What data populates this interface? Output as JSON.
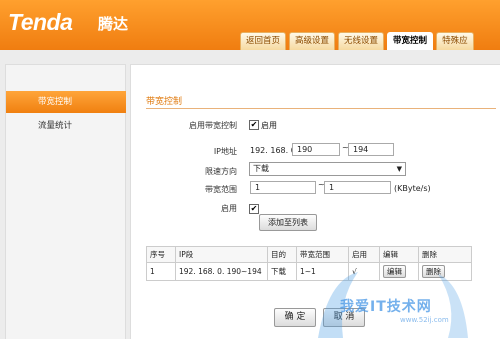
{
  "header": {
    "logo": "Tenda",
    "logo_cn": "腾达",
    "tabs": [
      {
        "label": "返回首页",
        "active": false
      },
      {
        "label": "高级设置",
        "active": false
      },
      {
        "label": "无线设置",
        "active": false
      },
      {
        "label": "带宽控制",
        "active": true
      },
      {
        "label": "特殊应",
        "active": false
      }
    ]
  },
  "sidebar": {
    "items": [
      {
        "label": "带宽控制",
        "active": true
      },
      {
        "label": "流量统计",
        "active": false
      }
    ]
  },
  "form": {
    "section_title": "带宽控制",
    "enable_bw_label": "启用带宽控制",
    "enable_bw_checked": true,
    "enable_bw_text": "启用",
    "ip_label": "IP地址",
    "ip_prefix": "192. 168. 0.",
    "ip_start": "190",
    "ip_sep": "~",
    "ip_end": "194",
    "direction_label": "限速方向",
    "direction_value": "下载",
    "range_label": "带宽范围",
    "range_min": "1",
    "range_sep": "~",
    "range_max": "1",
    "range_unit": "(KByte/s)",
    "enable_label": "启用",
    "enable_checked": true,
    "add_button": "添加至列表"
  },
  "table": {
    "headers": [
      "序号",
      "IP段",
      "目的",
      "带宽范围",
      "启用",
      "编辑",
      "删除"
    ],
    "rows": [
      {
        "index": "1",
        "ip": "192. 168. 0. 190~194",
        "direction": "下载",
        "range": "1~1",
        "enabled": "√",
        "edit": "编辑",
        "delete": "删除"
      }
    ]
  },
  "footer": {
    "ok_button": "确 定",
    "cancel_button": "取 消"
  },
  "watermark": {
    "text": "我爱IT技术网",
    "url": "www.52ij.com"
  }
}
